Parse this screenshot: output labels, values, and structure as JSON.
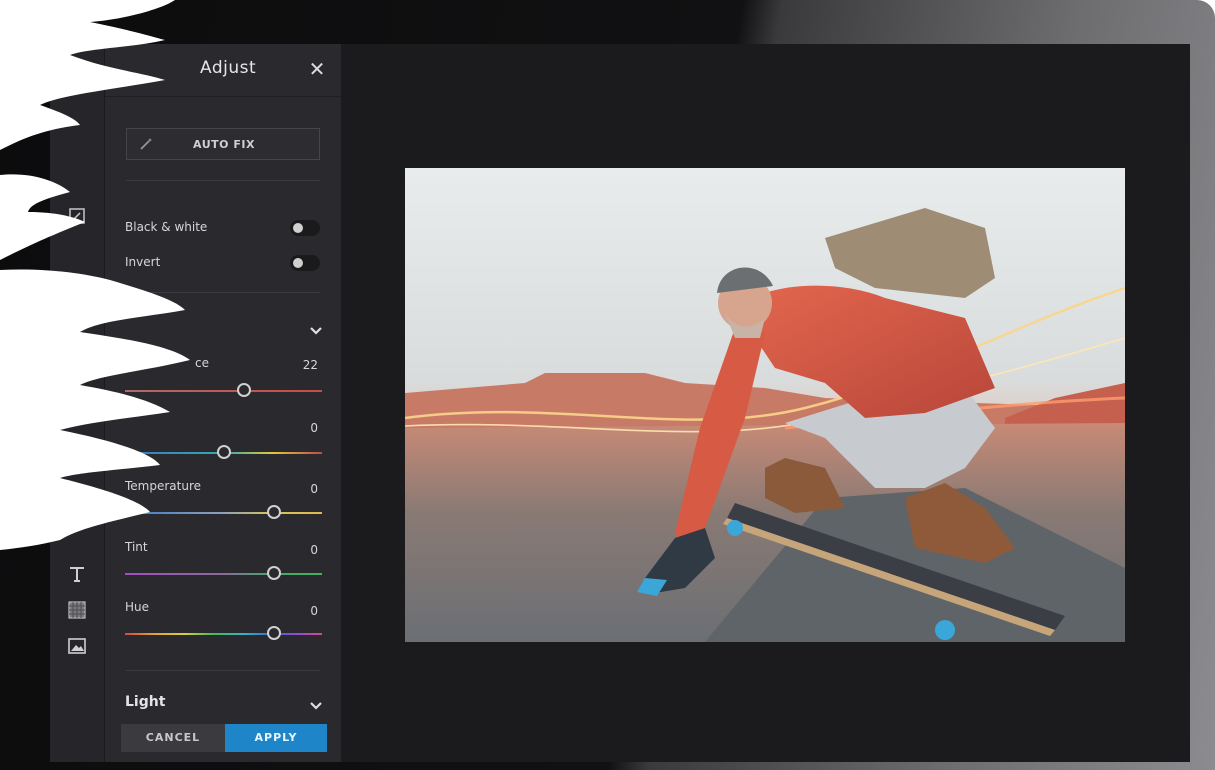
{
  "panel": {
    "title": "Adjust",
    "close_icon": "close-icon",
    "auto_fix_label": "AUTO FIX",
    "toggles": [
      {
        "label": "Black & white",
        "on": false
      },
      {
        "label": "Invert",
        "on": false
      }
    ],
    "color_section": {
      "sliders": [
        {
          "label": "",
          "visible_label_fragment": "ce",
          "value": "22"
        },
        {
          "label": "",
          "value": "0"
        },
        {
          "label": "Temperature",
          "value": "0"
        },
        {
          "label": "Tint",
          "value": "0"
        },
        {
          "label": "Hue",
          "value": "0"
        }
      ]
    },
    "light_section_title": "Light",
    "cancel_label": "CANCEL",
    "apply_label": "APPLY"
  },
  "tool_rail": {
    "icons": [
      "crop-icon",
      "wave-icon",
      "sticker-icon",
      "text-icon",
      "texture-icon",
      "image-icon"
    ]
  },
  "colors": {
    "accent": "#1e86c8",
    "panel_bg": "#2a2a2e",
    "screen_bg": "#1b1b1e"
  }
}
